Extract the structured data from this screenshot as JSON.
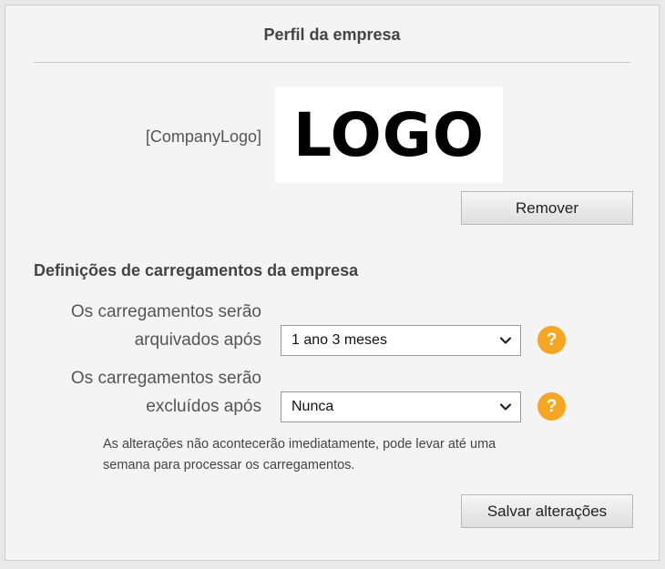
{
  "panel": {
    "title": "Perfil da empresa"
  },
  "logo": {
    "label": "[CompanyLogo]",
    "image_text": "LOGO",
    "remove_label": "Remover"
  },
  "uploads": {
    "section_title": "Definições de carregamentos da empresa",
    "archive": {
      "label_line1": "Os carregamentos serão",
      "label_line2": "arquivados após",
      "selected": "1 ano 3 meses"
    },
    "delete": {
      "label_line1": "Os carregamentos serão",
      "label_line2": "excluídos após",
      "selected": "Nunca"
    },
    "help_glyph": "?",
    "note_line1": "As alterações não acontecerão imediatamente, pode levar até uma",
    "note_line2": "semana para processar os carregamentos.",
    "save_label": "Salvar alterações"
  },
  "colors": {
    "help_accent": "#f5a623",
    "panel_bg": "#f5f4f4"
  },
  "icons": {
    "help": "help-circle-icon",
    "dropdown": "chevron-down-icon"
  }
}
